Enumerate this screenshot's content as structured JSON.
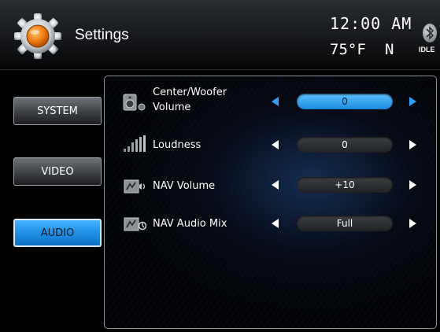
{
  "header": {
    "title": "Settings",
    "time": "12:00 AM",
    "temperature": "75°F",
    "heading": "N",
    "bt_status": "IDLE"
  },
  "tabs": [
    {
      "label": "SYSTEM",
      "active": false
    },
    {
      "label": "VIDEO",
      "active": false
    },
    {
      "label": "AUDIO",
      "active": true
    }
  ],
  "settings": [
    {
      "label_line1": "Center/Woofer",
      "label_line2": "Volume",
      "value": "0",
      "highlighted": true,
      "icon": "speaker-icon"
    },
    {
      "label": "Loudness",
      "value": "0",
      "highlighted": false,
      "icon": "loudness-bars-icon"
    },
    {
      "label": "NAV Volume",
      "value": "+10",
      "highlighted": false,
      "icon": "nav-volume-icon"
    },
    {
      "label": "NAV Audio Mix",
      "value": "Full",
      "highlighted": false,
      "icon": "nav-audio-mix-icon"
    }
  ],
  "colors": {
    "accent": "#2f9cff",
    "active_tab": "#1f8fe6",
    "gear_orange": "#f07a10"
  }
}
